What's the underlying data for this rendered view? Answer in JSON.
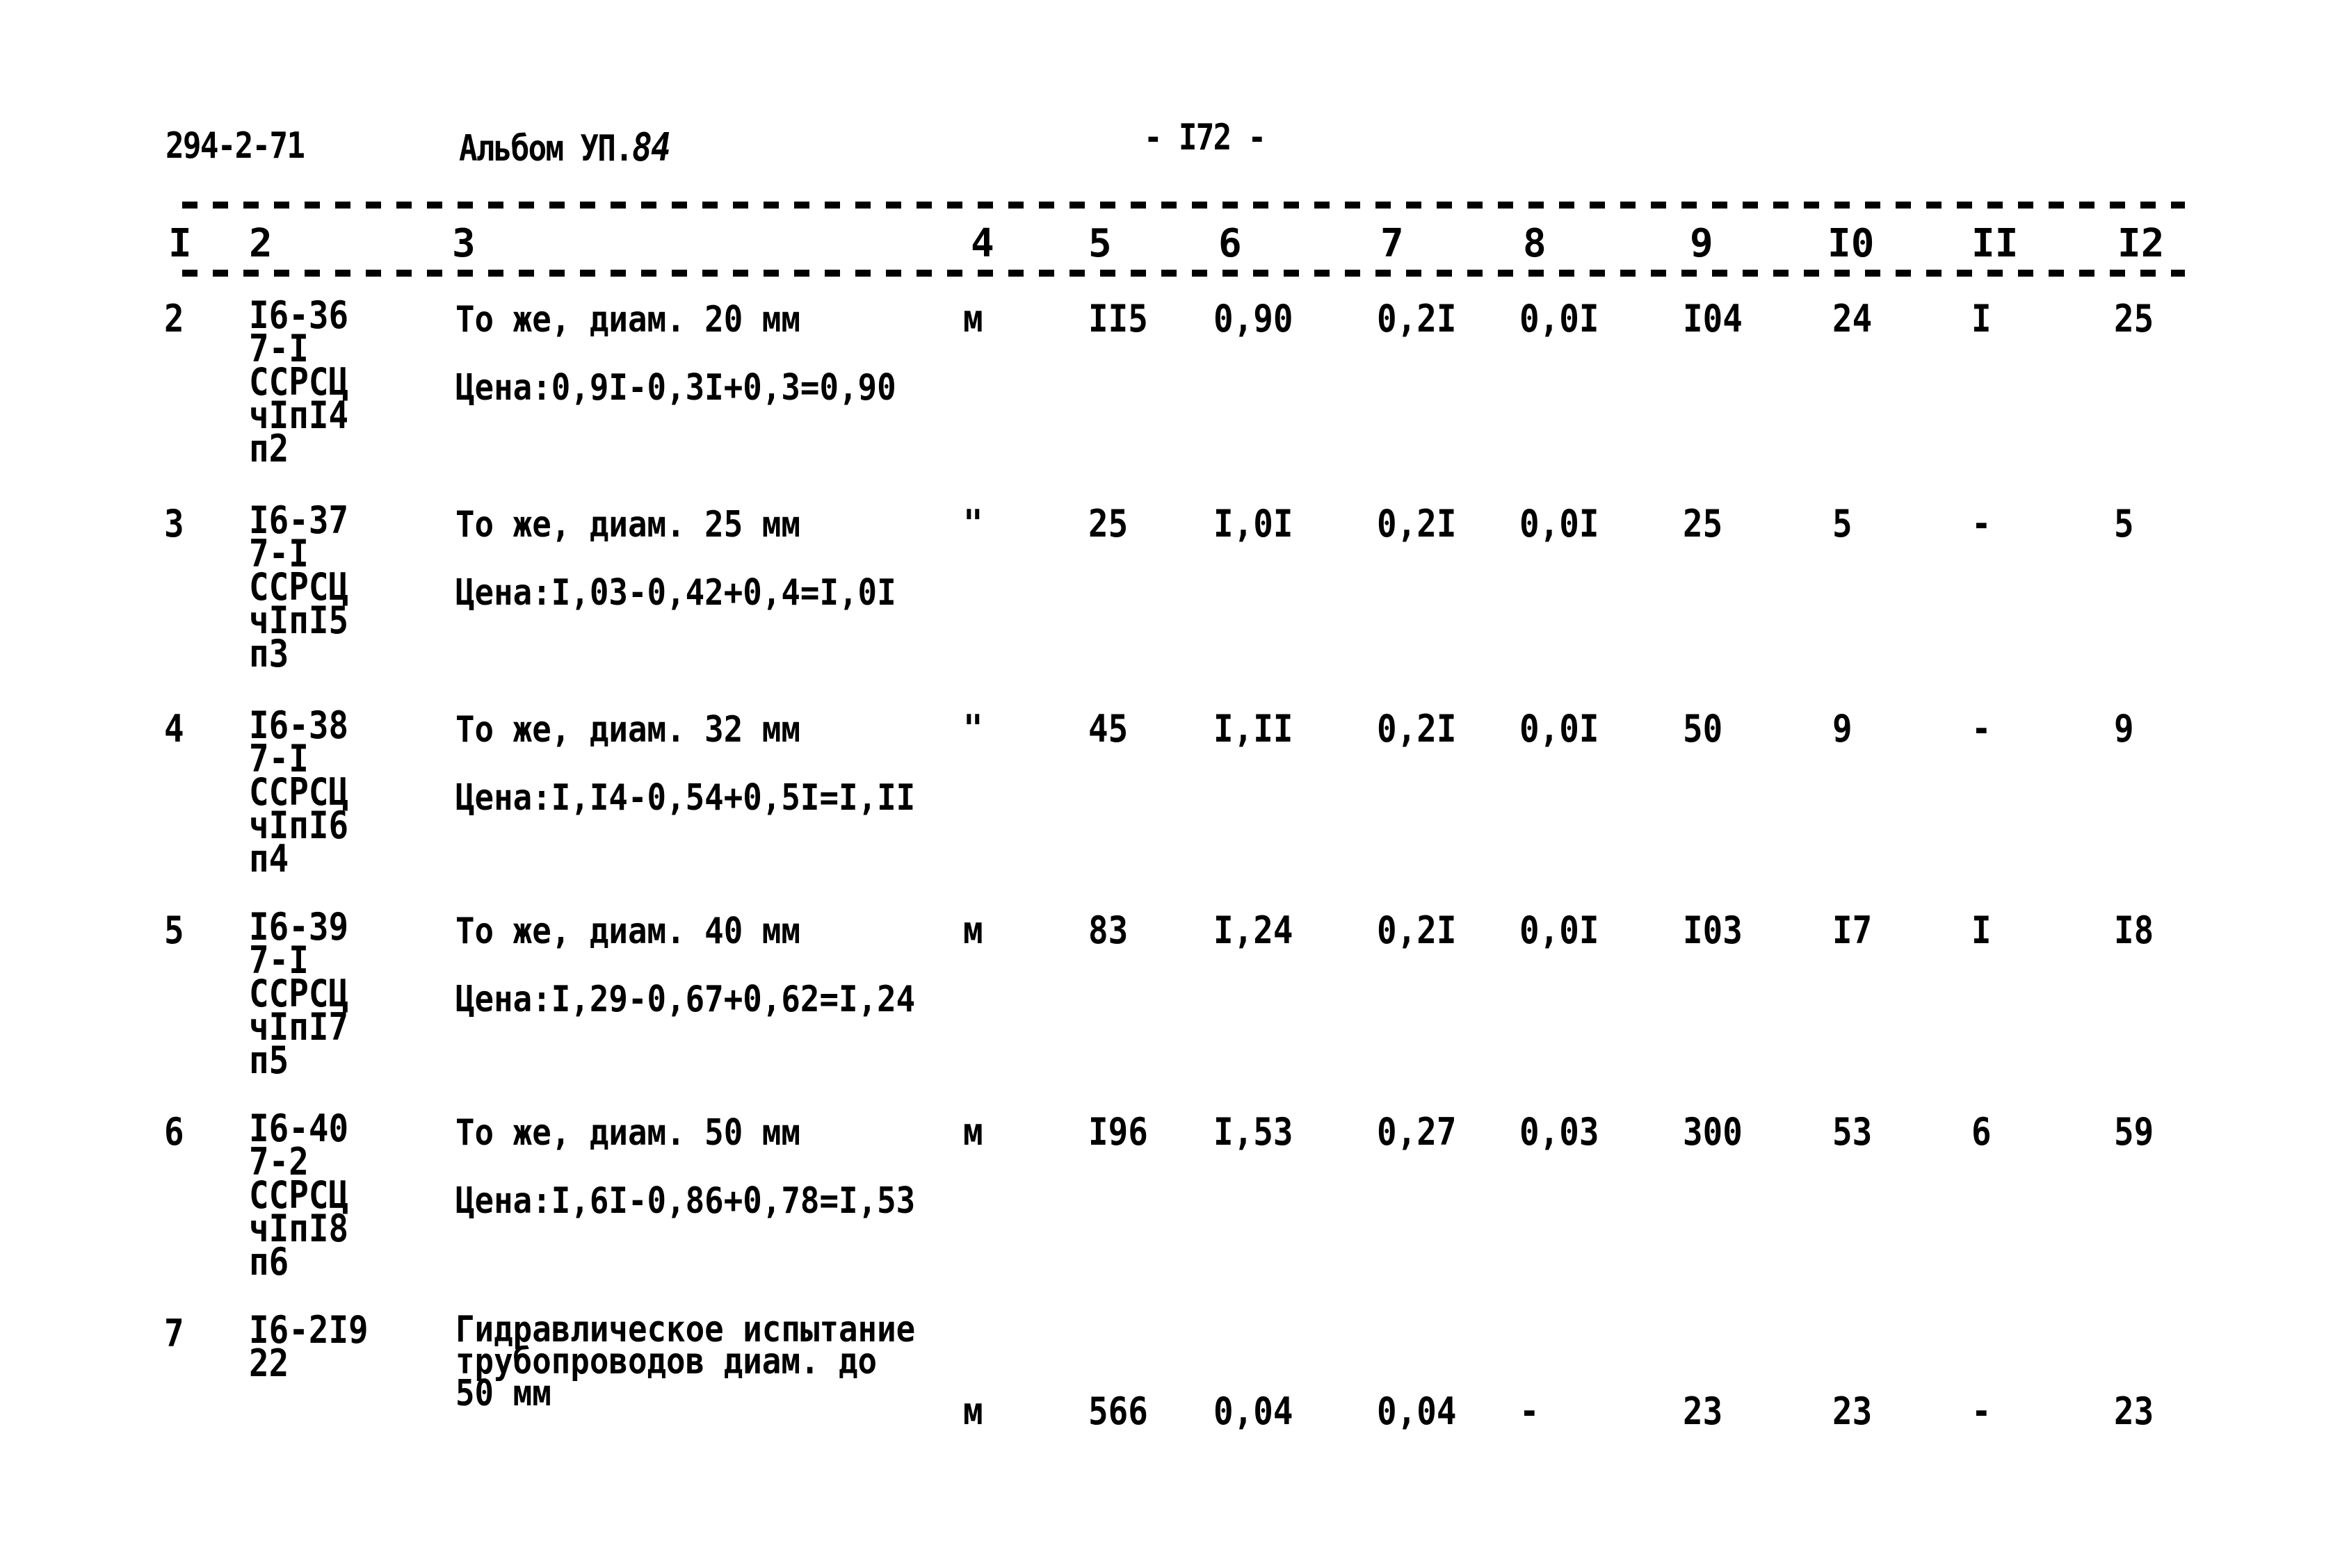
{
  "header": {
    "doc_code": "294-2-71",
    "album_label": "Альбом УП.",
    "album_number": "84",
    "page_number": "- I72 -"
  },
  "columns": [
    "I",
    "2",
    "3",
    "4",
    "5",
    "6",
    "7",
    "8",
    "9",
    "I0",
    "II",
    "I2"
  ],
  "rows": [
    {
      "num": "2",
      "code": [
        "I6-36",
        "7-I",
        "ССРСЦ",
        "чIпI4",
        "п2"
      ],
      "description": "То же, диам. 20 мм",
      "price_note": "Цена:0,9I-0,3I+0,3=0,90",
      "unit": "м",
      "c5": "II5",
      "c6": "0,90",
      "c7": "0,2I",
      "c8": "0,0I",
      "c9": "I04",
      "c10": "24",
      "c11": "I",
      "c12": "25"
    },
    {
      "num": "3",
      "code": [
        "I6-37",
        "7-I",
        "ССРСЦ",
        "чIпI5",
        "п3"
      ],
      "description": "То же, диам. 25 мм",
      "price_note": "Цена:I,03-0,42+0,4=I,0I",
      "unit": "\"",
      "c5": "25",
      "c6": "I,0I",
      "c7": "0,2I",
      "c8": "0,0I",
      "c9": "25",
      "c10": "5",
      "c11": "-",
      "c12": "5"
    },
    {
      "num": "4",
      "code": [
        "I6-38",
        "7-I",
        "ССРСЦ",
        "чIпI6",
        "п4"
      ],
      "description": "То же, диам. 32 мм",
      "price_note": "Цена:I,I4-0,54+0,5I=I,II",
      "unit": "\"",
      "c5": "45",
      "c6": "I,II",
      "c7": "0,2I",
      "c8": "0,0I",
      "c9": "50",
      "c10": "9",
      "c11": "-",
      "c12": "9"
    },
    {
      "num": "5",
      "code": [
        "I6-39",
        "7-I",
        "ССРСЦ",
        "чIпI7",
        "п5"
      ],
      "description": "То же, диам. 40 мм",
      "price_note": "Цена:I,29-0,67+0,62=I,24",
      "unit": "м",
      "c5": "83",
      "c6": "I,24",
      "c7": "0,2I",
      "c8": "0,0I",
      "c9": "I03",
      "c10": "I7",
      "c11": "I",
      "c12": "I8"
    },
    {
      "num": "6",
      "code": [
        "I6-40",
        "7-2",
        "ССРСЦ",
        "чIпI8",
        "п6"
      ],
      "description": "То же, диам. 50 мм",
      "price_note": "Цена:I,6I-0,86+0,78=I,53",
      "unit": "м",
      "c5": "I96",
      "c6": "I,53",
      "c7": "0,27",
      "c8": "0,03",
      "c9": "300",
      "c10": "53",
      "c11": "6",
      "c12": "59"
    },
    {
      "num": "7",
      "code": [
        "I6-2I9",
        "22"
      ],
      "description_lines": [
        "Гидравлическое испытание",
        "трубопроводов диам. до",
        "50 мм"
      ],
      "unit": "м",
      "c5": "566",
      "c6": "0,04",
      "c7": "0,04",
      "c8": "-",
      "c9": "23",
      "c10": "23",
      "c11": "-",
      "c12": "23"
    }
  ]
}
